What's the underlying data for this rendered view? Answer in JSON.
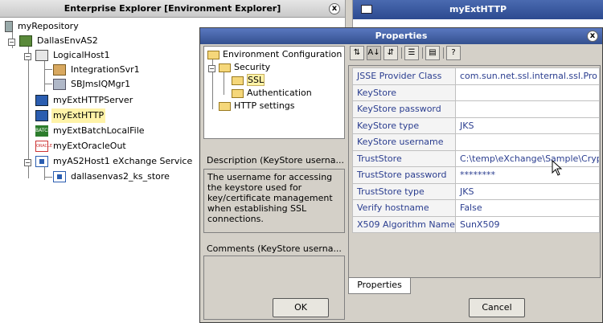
{
  "explorer": {
    "title": "Enterprise Explorer [Environment Explorer]",
    "close": "x",
    "tree": {
      "repository": "myRepository",
      "environment": "DallasEnvAS2",
      "logical_host": "LogicalHost1",
      "integration_server": "IntegrationSvr1",
      "jms_manager": "SBJmsIQMgr1",
      "ext_http_server": "myExtHTTPServer",
      "ext_http": "myExtHTTP",
      "ext_batch": "myExtBatchLocalFile",
      "ext_oracle": "myExtOracleOut",
      "as2_host": "myAS2Host1 eXchange Service",
      "ks_store": "dallasenvas2_ks_store"
    }
  },
  "editor": {
    "title": "myExtHTTP"
  },
  "dialog": {
    "title": "Properties",
    "close": "x",
    "config_tree": {
      "root": "Environment Configuration",
      "security": "Security",
      "ssl": "SSL",
      "authentication": "Authentication",
      "http_settings": "HTTP settings"
    },
    "description_label": "Description (KeyStore userna...",
    "description_text": "The username for accessing the keystore used for key/certificate management when establishing SSL connections.",
    "comments_label": "Comments (KeyStore userna...",
    "properties": [
      {
        "key": "JSSE Provider Class",
        "value": "com.sun.net.ssl.internal.ssl.Pro"
      },
      {
        "key": "KeyStore",
        "value": ""
      },
      {
        "key": "KeyStore password",
        "value": ""
      },
      {
        "key": "KeyStore type",
        "value": "JKS"
      },
      {
        "key": "KeyStore username",
        "value": ""
      },
      {
        "key": "TrustStore",
        "value": "C:\\temp\\eXchange\\Sample\\Cryp"
      },
      {
        "key": "TrustStore password",
        "value": "********"
      },
      {
        "key": "TrustStore type",
        "value": "JKS"
      },
      {
        "key": "Verify hostname",
        "value": "False"
      },
      {
        "key": "X509 Algorithm Name",
        "value": "SunX509"
      }
    ],
    "properties_tab": "Properties",
    "ok_label": "OK",
    "cancel_label": "Cancel"
  }
}
